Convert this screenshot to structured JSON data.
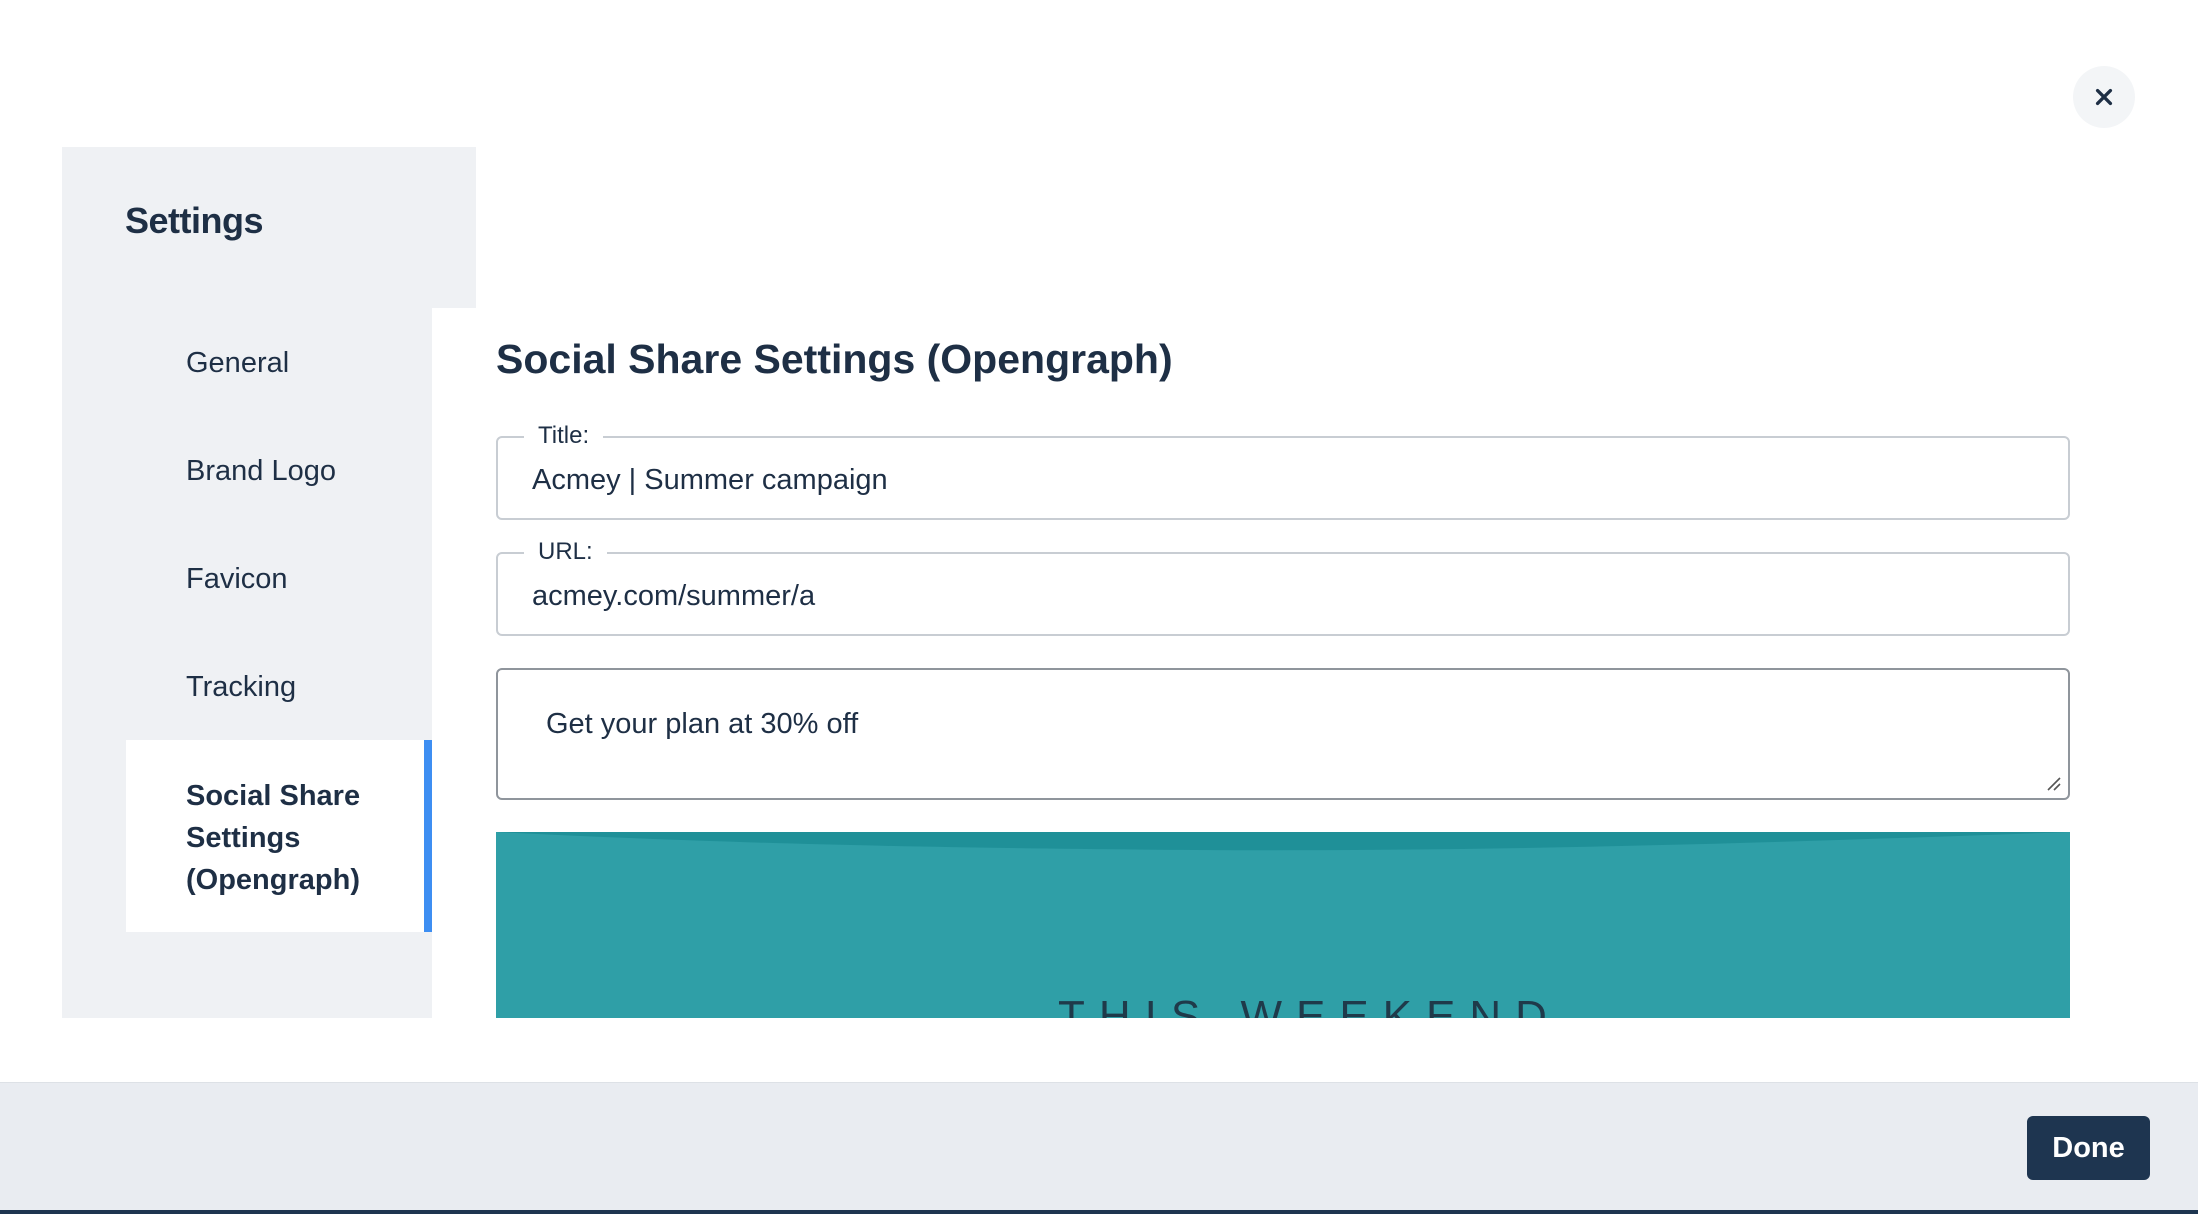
{
  "dialog": {
    "close_label": "×"
  },
  "sidebar": {
    "title": "Settings",
    "items": [
      {
        "label": "General"
      },
      {
        "label": "Brand Logo"
      },
      {
        "label": "Favicon"
      },
      {
        "label": "Tracking"
      },
      {
        "label": "Social Share Settings (Opengraph)",
        "active": true
      }
    ]
  },
  "main": {
    "title": "Social Share Settings (Opengraph)",
    "fields": {
      "title": {
        "label": "Title:",
        "value": "Acmey | Summer campaign"
      },
      "url": {
        "label": "URL:",
        "value": "acmey.com/summer/a"
      },
      "description": {
        "value": "Get your plan at 30% off"
      }
    },
    "preview": {
      "caption": "THIS WEEKEND",
      "color": "#2f9fa7"
    }
  },
  "footer": {
    "done_label": "Done"
  },
  "colors": {
    "accent": "#3d8ef2",
    "primary": "#1e3550",
    "sidebar_bg": "#eff1f4"
  }
}
